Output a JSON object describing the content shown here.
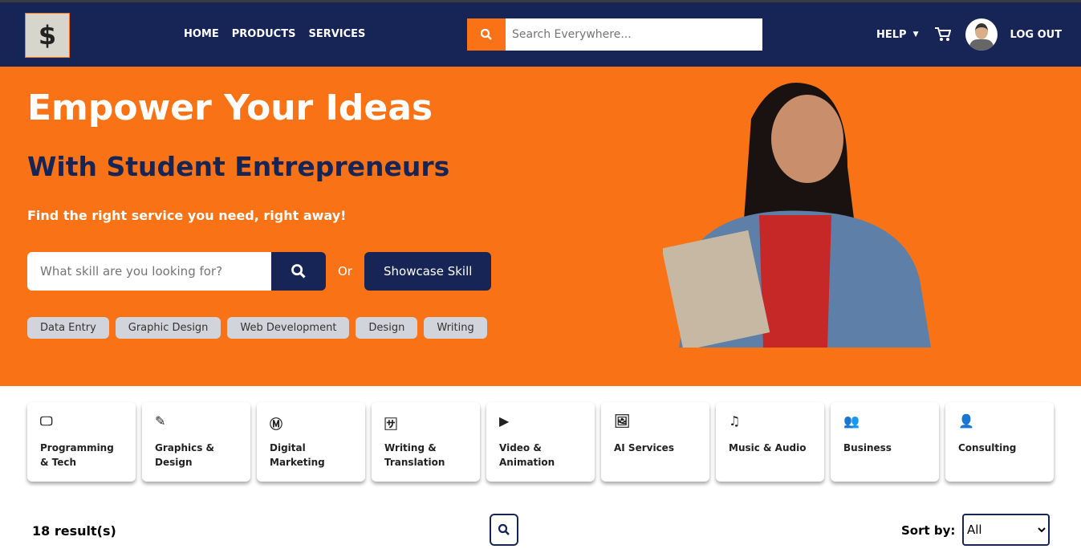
{
  "nav": {
    "logo": "$",
    "links": [
      "HOME",
      "PRODUCTS",
      "SERVICES"
    ],
    "search_placeholder": "Search Everywhere...",
    "help": "HELP",
    "logout": "LOG OUT"
  },
  "hero": {
    "title": "Empower Your Ideas",
    "subtitle": "With Student Entrepreneurs",
    "tagline": "Find the right service you need, right away!",
    "skill_placeholder": "What skill are you looking for?",
    "or": "Or",
    "showcase": "Showcase Skill",
    "tags": [
      "Data Entry",
      "Graphic Design",
      "Web Development",
      "Design",
      "Writing"
    ]
  },
  "categories": [
    {
      "icon": "monitor-icon",
      "glyph": "🖵",
      "label": "Programming & Tech"
    },
    {
      "icon": "pen-ruler-icon",
      "glyph": "✎",
      "label": "Graphics & Design"
    },
    {
      "icon": "marketing-icon",
      "glyph": "Ⓜ",
      "label": "Digital Marketing"
    },
    {
      "icon": "translate-icon",
      "glyph": "🈂",
      "label": "Writing & Translation"
    },
    {
      "icon": "video-icon",
      "glyph": "▶",
      "label": "Video & Animation"
    },
    {
      "icon": "image-icon",
      "glyph": "🖼",
      "label": "AI Services"
    },
    {
      "icon": "music-icon",
      "glyph": "♫",
      "label": "Music & Audio"
    },
    {
      "icon": "users-icon",
      "glyph": "👥",
      "label": "Business"
    },
    {
      "icon": "consult-icon",
      "glyph": "👤",
      "label": "Consulting"
    }
  ],
  "results": {
    "count": "18 result(s)",
    "sort_label": "Sort by:",
    "sort_value": "All"
  }
}
